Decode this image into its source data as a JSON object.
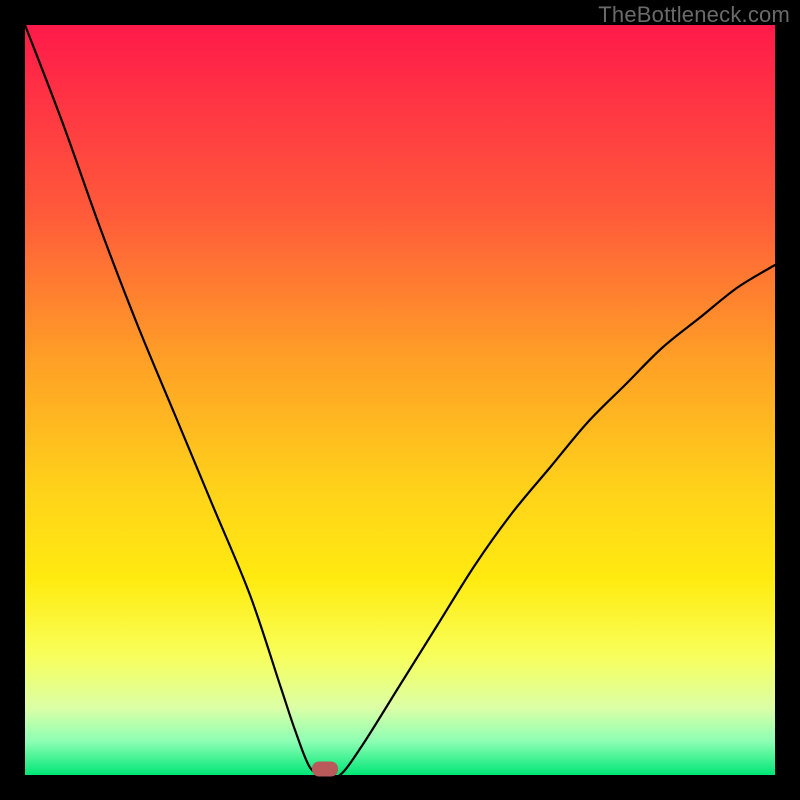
{
  "watermark": "TheBottleneck.com",
  "chart_data": {
    "type": "line",
    "title": "",
    "xlabel": "",
    "ylabel": "",
    "xlim": [
      0,
      100
    ],
    "ylim": [
      0,
      100
    ],
    "grid": false,
    "legend": false,
    "series": [
      {
        "name": "bottleneck-curve",
        "x": [
          0,
          5,
          10,
          15,
          20,
          25,
          30,
          34,
          36,
          38,
          40,
          42,
          45,
          50,
          55,
          60,
          65,
          70,
          75,
          80,
          85,
          90,
          95,
          100
        ],
        "values": [
          100,
          87,
          73,
          60,
          48,
          36,
          24,
          12,
          6,
          1,
          0,
          0,
          4,
          12,
          20,
          28,
          35,
          41,
          47,
          52,
          57,
          61,
          65,
          68
        ]
      }
    ],
    "optimal_point": {
      "x": 40,
      "y": 0
    },
    "background": "red-orange-yellow-green vertical gradient"
  },
  "colors": {
    "curve": "#000000",
    "marker": "#b95959",
    "frame": "#000000"
  }
}
